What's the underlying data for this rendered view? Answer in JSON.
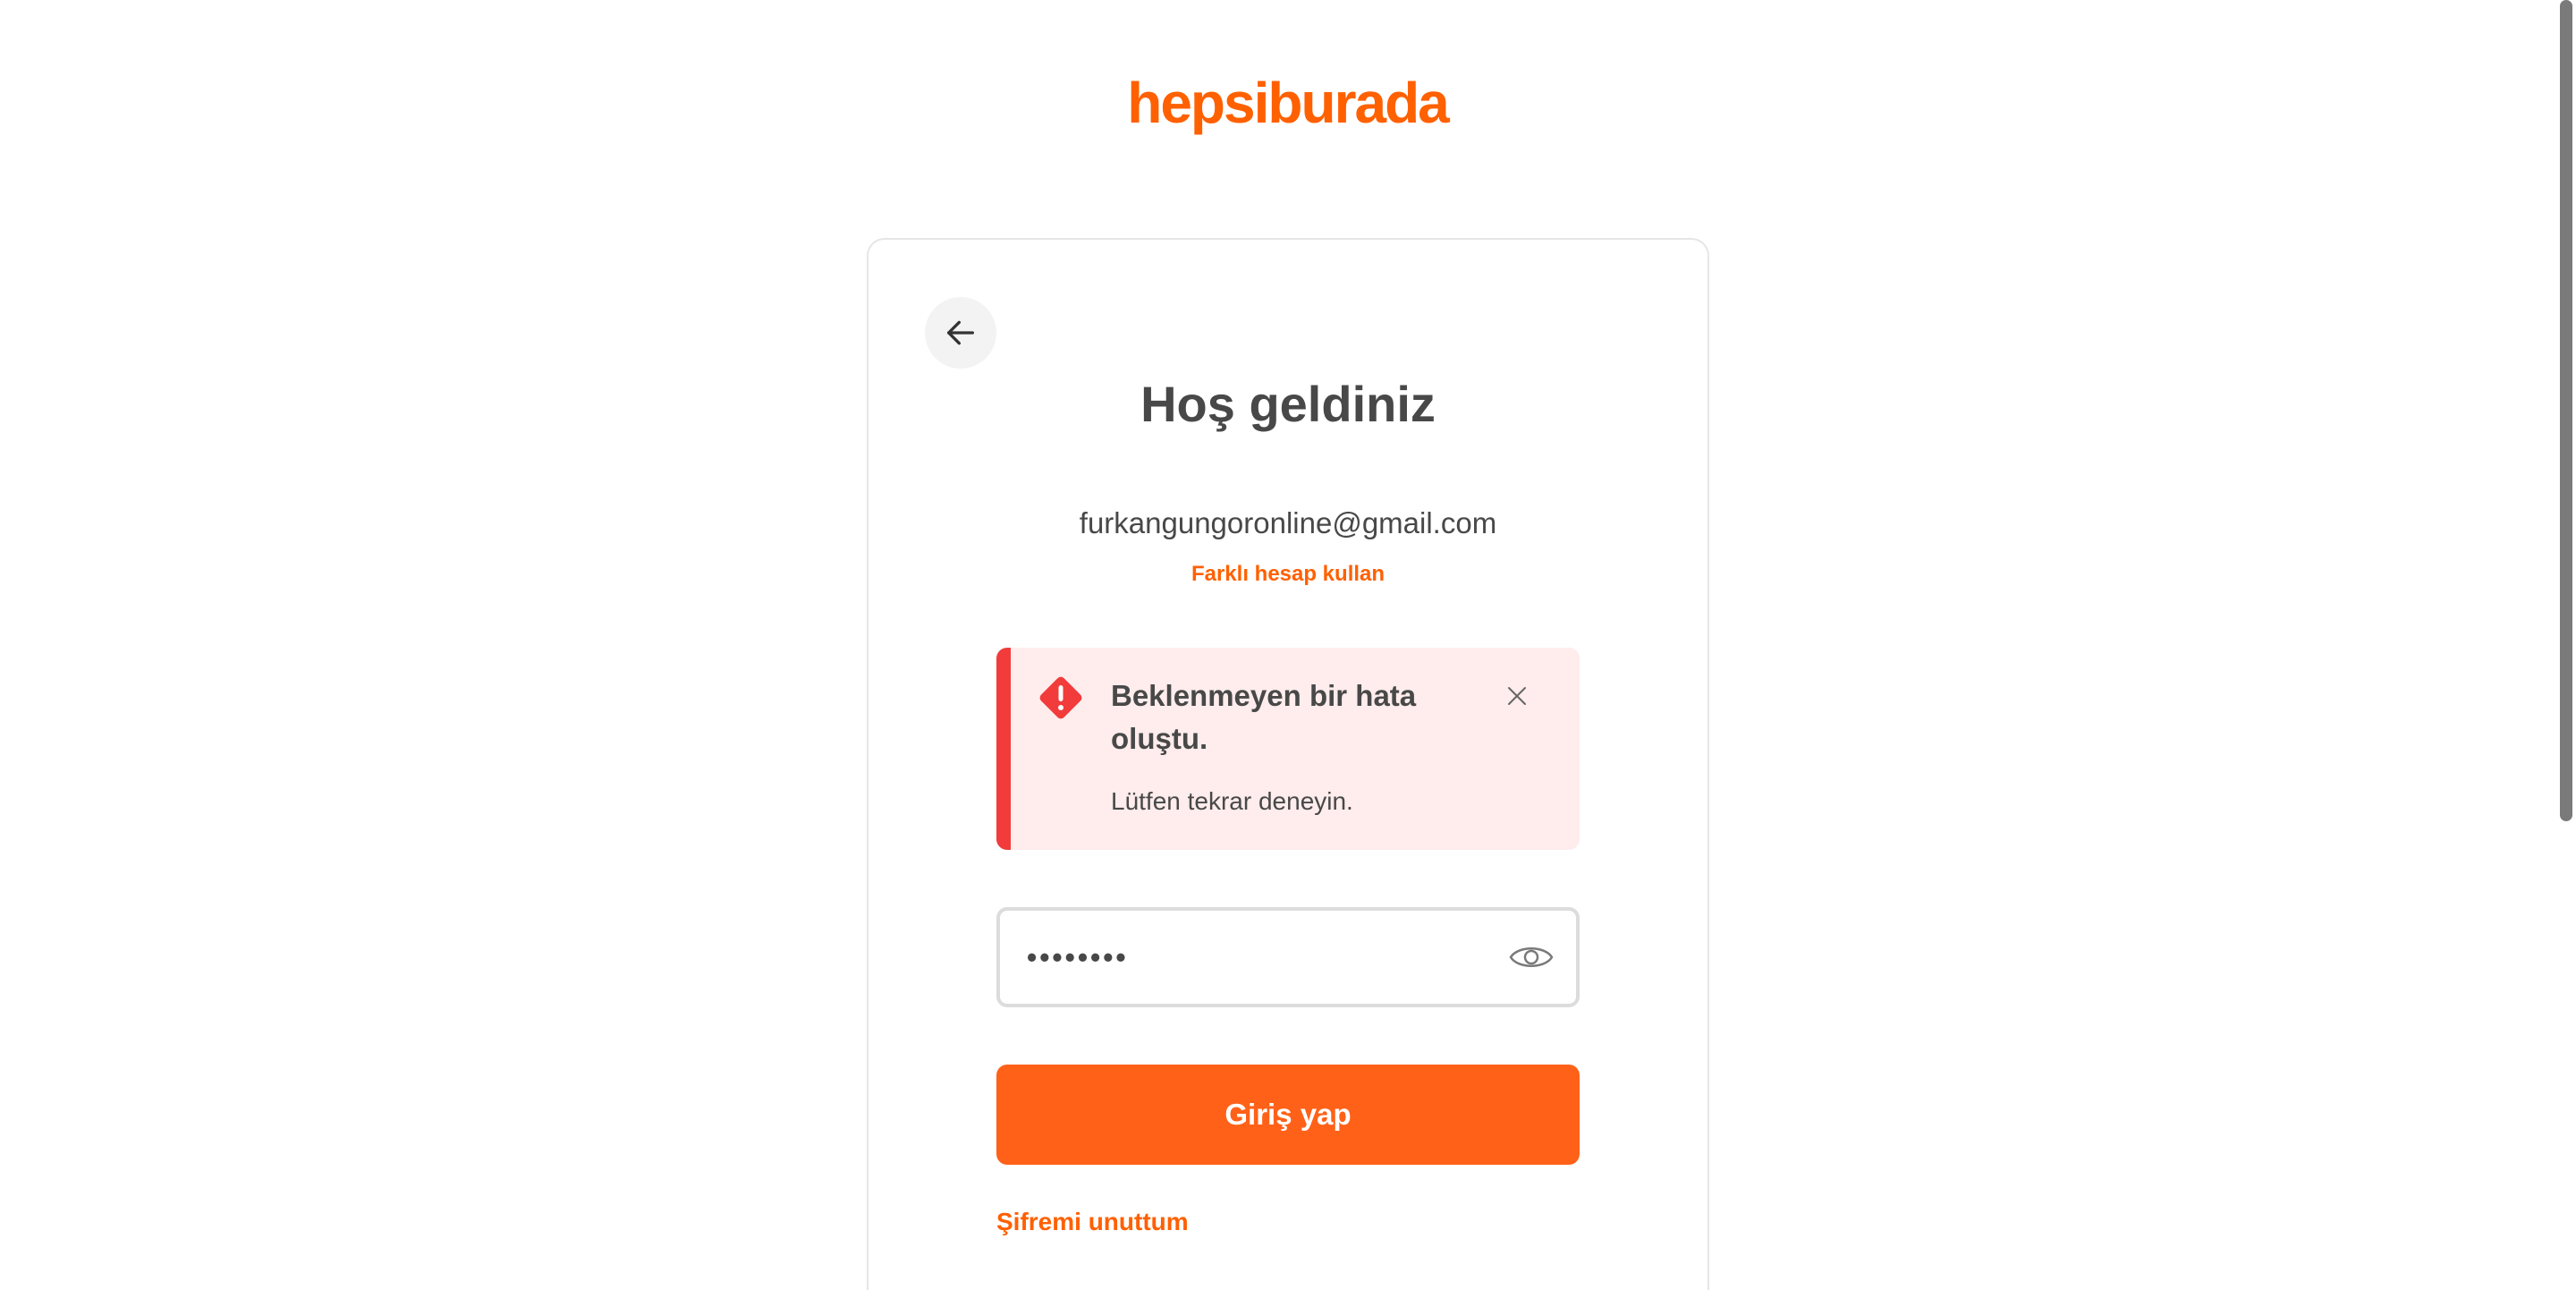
{
  "brand": {
    "logo_text": "hepsiburada",
    "accent_color": "#ff6000",
    "error_color": "#f23b3b"
  },
  "login": {
    "back_icon": "arrow-left-icon",
    "title": "Hoş geldiniz",
    "email": "furkangungoronline@gmail.com",
    "switch_account_label": "Farklı hesap kullan",
    "alert": {
      "icon": "warning-diamond-icon",
      "title": "Beklenmeyen bir hata oluştu.",
      "description": "Lütfen tekrar deneyin.",
      "close_icon": "close-icon"
    },
    "password": {
      "masked_value": "••••••••",
      "toggle_icon": "eye-icon"
    },
    "submit_label": "Giriş yap",
    "forgot_password_label": "Şifremi unuttum"
  }
}
